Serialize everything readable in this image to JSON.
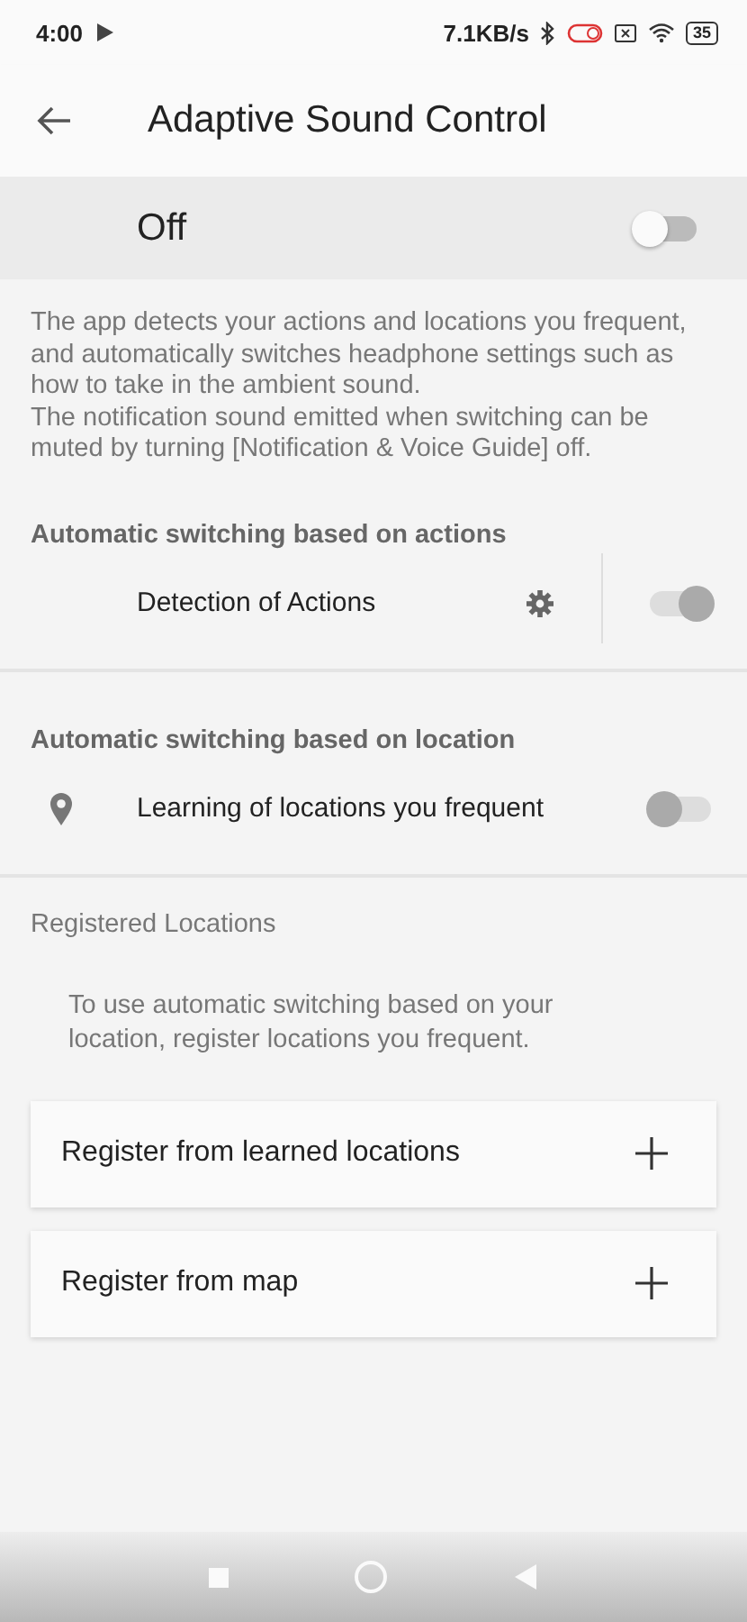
{
  "status_bar": {
    "time": "4:00",
    "speed": "7.1KB/s",
    "battery": "35"
  },
  "app_bar": {
    "title": "Adaptive Sound Control"
  },
  "master": {
    "label": "Off",
    "on": false
  },
  "description": "The app detects your actions and locations you frequent, and automatically switches headphone settings such as how to take in the ambient sound.\nThe notification sound emitted when switching can be muted by turning [Notification & Voice Guide] off.",
  "sections": [
    {
      "heading": "Automatic switching based on actions",
      "row": {
        "kind": "actions",
        "label": "Detection of Actions",
        "on": true,
        "disabled": true
      }
    },
    {
      "heading": "Automatic switching based on location",
      "row": {
        "kind": "location",
        "label": "Learning of locations you frequent",
        "on": false,
        "disabled": true
      }
    }
  ],
  "registered": {
    "heading": "Registered Locations",
    "hint": "To use automatic switching based on your location, register locations you frequent.",
    "buttons": [
      {
        "label": "Register from learned locations"
      },
      {
        "label": "Register from map"
      }
    ]
  }
}
